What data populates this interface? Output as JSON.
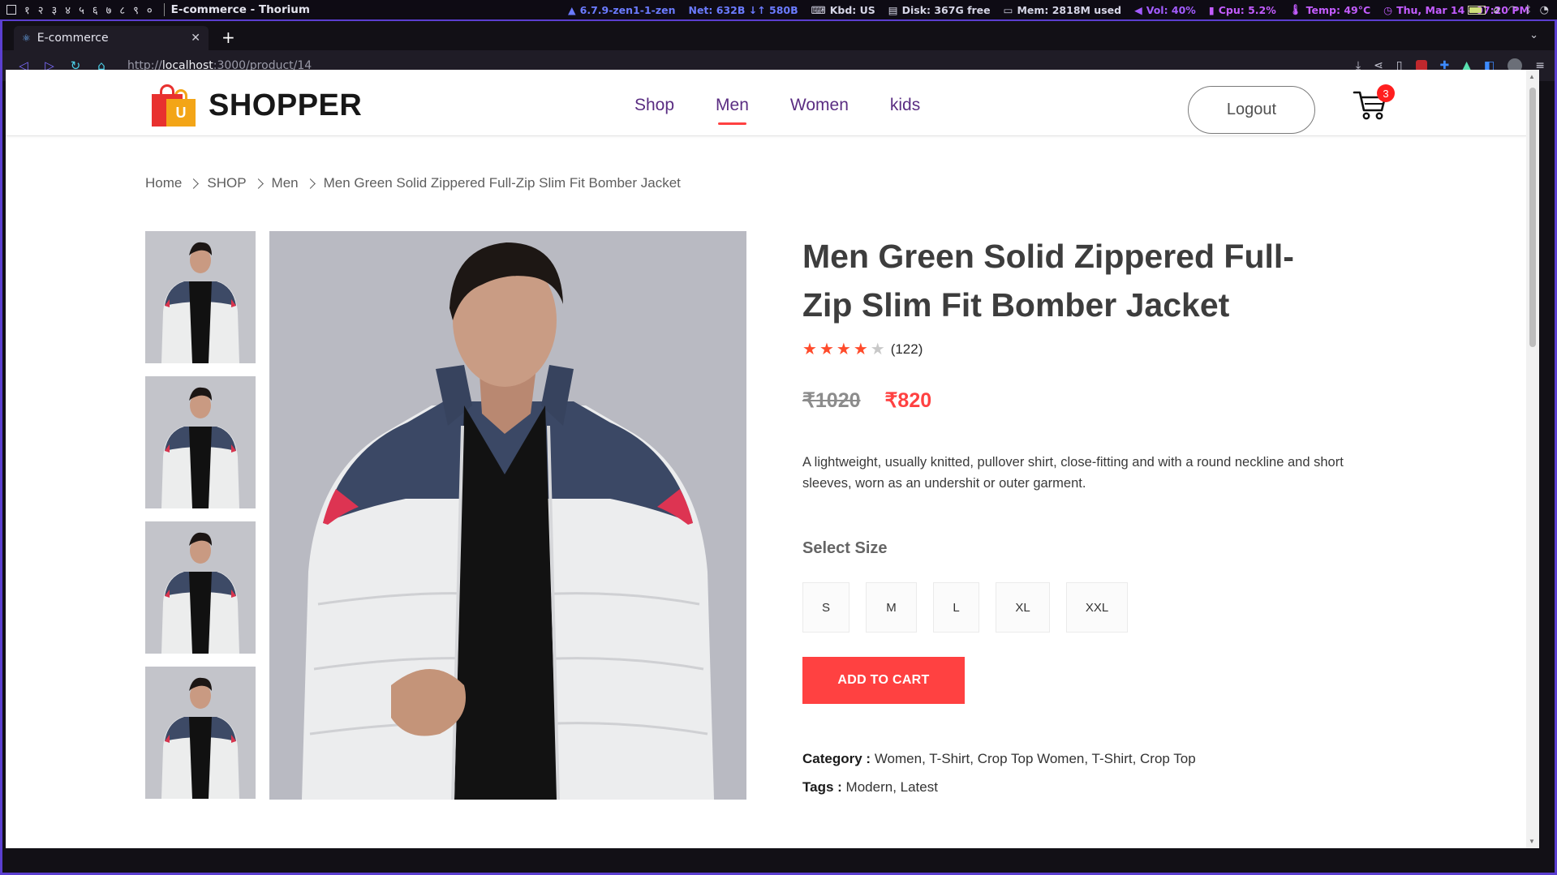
{
  "system_bar": {
    "workspaces": [
      "१",
      "२",
      "३",
      "४",
      "५",
      "६",
      "७",
      "८",
      "९",
      "०"
    ],
    "window_title": "E-commerce - Thorium",
    "kernel": "6.7.9-zen1-1-zen",
    "net": "Net: 632B ↓↑ 580B",
    "kbd": "Kbd: US",
    "disk": "Disk: 367G free",
    "mem": "Mem: 2818M used",
    "vol": "Vol: 40%",
    "cpu": "Cpu: 5.2%",
    "temp": "Temp: 49°C",
    "datetime": "Thu, Mar 14 - 07:20 PM"
  },
  "browser": {
    "tab_title": "E-commerce",
    "url_scheme": "http://",
    "url_host": "localhost",
    "url_path": ":3000/product/14"
  },
  "header": {
    "logo_text": "SHOPPER",
    "logo_badge": "U",
    "menu": [
      {
        "label": "Shop",
        "active": false
      },
      {
        "label": "Men",
        "active": true
      },
      {
        "label": "Women",
        "active": false
      },
      {
        "label": "kids",
        "active": false
      }
    ],
    "logout_label": "Logout",
    "cart_count": "3"
  },
  "breadcrumb": [
    "Home",
    "SHOP",
    "Men",
    "Men Green Solid Zippered Full-Zip Slim Fit Bomber Jacket"
  ],
  "product": {
    "title_line1": "Men Green Solid Zippered Full-",
    "title_line2": "Zip Slim Fit Bomber Jacket",
    "rating": 4,
    "rating_max": 5,
    "review_count": "(122)",
    "old_price": "₹1020",
    "new_price": "₹820",
    "description": "A lightweight, usually knitted, pullover shirt, close-fitting and with a round neckline and short sleeves, worn as an undershit or outer garment.",
    "size_title": "Select Size",
    "sizes": [
      "S",
      "M",
      "L",
      "XL",
      "XXL"
    ],
    "add_to_cart": "ADD TO CART",
    "category_label": "Category :",
    "category_value": "Women, T-Shirt, Crop Top Women, T-Shirt, Crop Top",
    "tags_label": "Tags :",
    "tags_value": "Modern, Latest"
  },
  "colors": {
    "accent": "#ff4141",
    "menu_text": "#5a2d82",
    "star": "#ff4b2b",
    "frame_border": "#5b3fd0"
  }
}
